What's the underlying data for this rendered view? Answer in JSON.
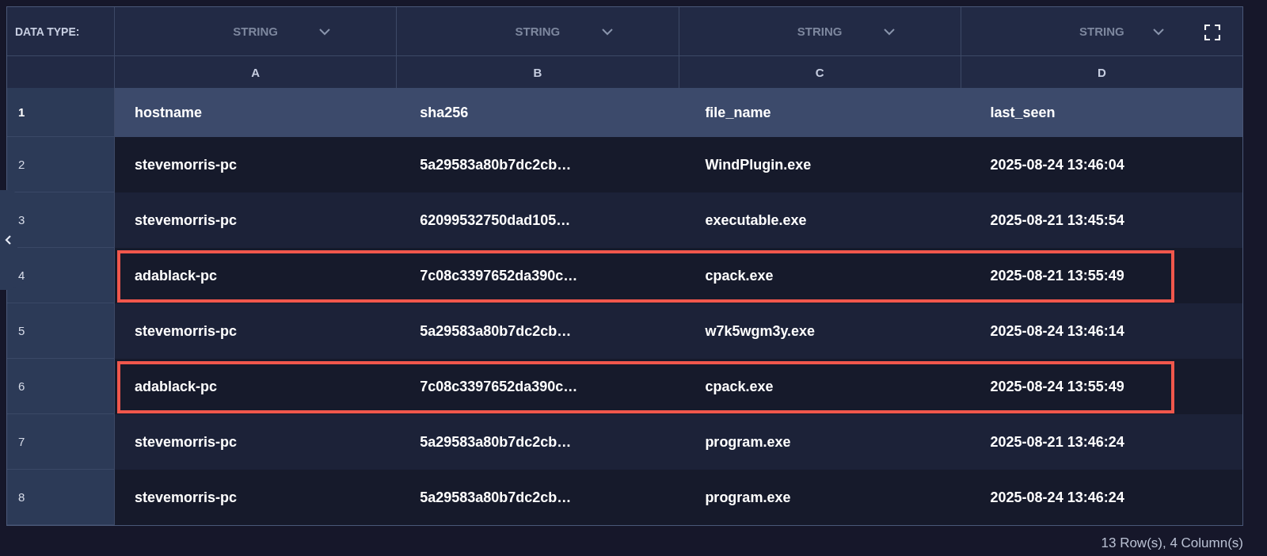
{
  "table": {
    "type_label": "DATA TYPE:",
    "columns": [
      {
        "type": "STRING",
        "letter": "A"
      },
      {
        "type": "STRING",
        "letter": "B"
      },
      {
        "type": "STRING",
        "letter": "C"
      },
      {
        "type": "STRING",
        "letter": "D"
      }
    ],
    "rows": [
      {
        "number": "1",
        "kind": "header",
        "flagged": false,
        "cells": [
          "hostname",
          "sha256",
          "file_name",
          "last_seen"
        ]
      },
      {
        "number": "2",
        "kind": "data",
        "flagged": false,
        "cells": [
          "stevemorris-pc",
          "5a29583a80b7dc2cb…",
          "WindPlugin.exe",
          "2025-08-24 13:46:04"
        ]
      },
      {
        "number": "3",
        "kind": "data",
        "flagged": false,
        "cells": [
          "stevemorris-pc",
          "62099532750dad105…",
          "executable.exe",
          "2025-08-21 13:45:54"
        ]
      },
      {
        "number": "4",
        "kind": "data",
        "flagged": true,
        "cells": [
          "adablack-pc",
          "7c08c3397652da390c…",
          "cpack.exe",
          "2025-08-21 13:55:49"
        ]
      },
      {
        "number": "5",
        "kind": "data",
        "flagged": false,
        "cells": [
          "stevemorris-pc",
          "5a29583a80b7dc2cb…",
          "w7k5wgm3y.exe",
          "2025-08-24 13:46:14"
        ]
      },
      {
        "number": "6",
        "kind": "data",
        "flagged": true,
        "cells": [
          "adablack-pc",
          "7c08c3397652da390c…",
          "cpack.exe",
          "2025-08-24 13:55:49"
        ]
      },
      {
        "number": "7",
        "kind": "data",
        "flagged": false,
        "cells": [
          "stevemorris-pc",
          "5a29583a80b7dc2cb…",
          "program.exe",
          "2025-08-21 13:46:24"
        ]
      },
      {
        "number": "8",
        "kind": "data",
        "flagged": false,
        "cells": [
          "stevemorris-pc",
          "5a29583a80b7dc2cb…",
          "program.exe",
          "2025-08-24 13:46:24"
        ]
      }
    ]
  },
  "status_bar": "13 Row(s), 4 Column(s)"
}
